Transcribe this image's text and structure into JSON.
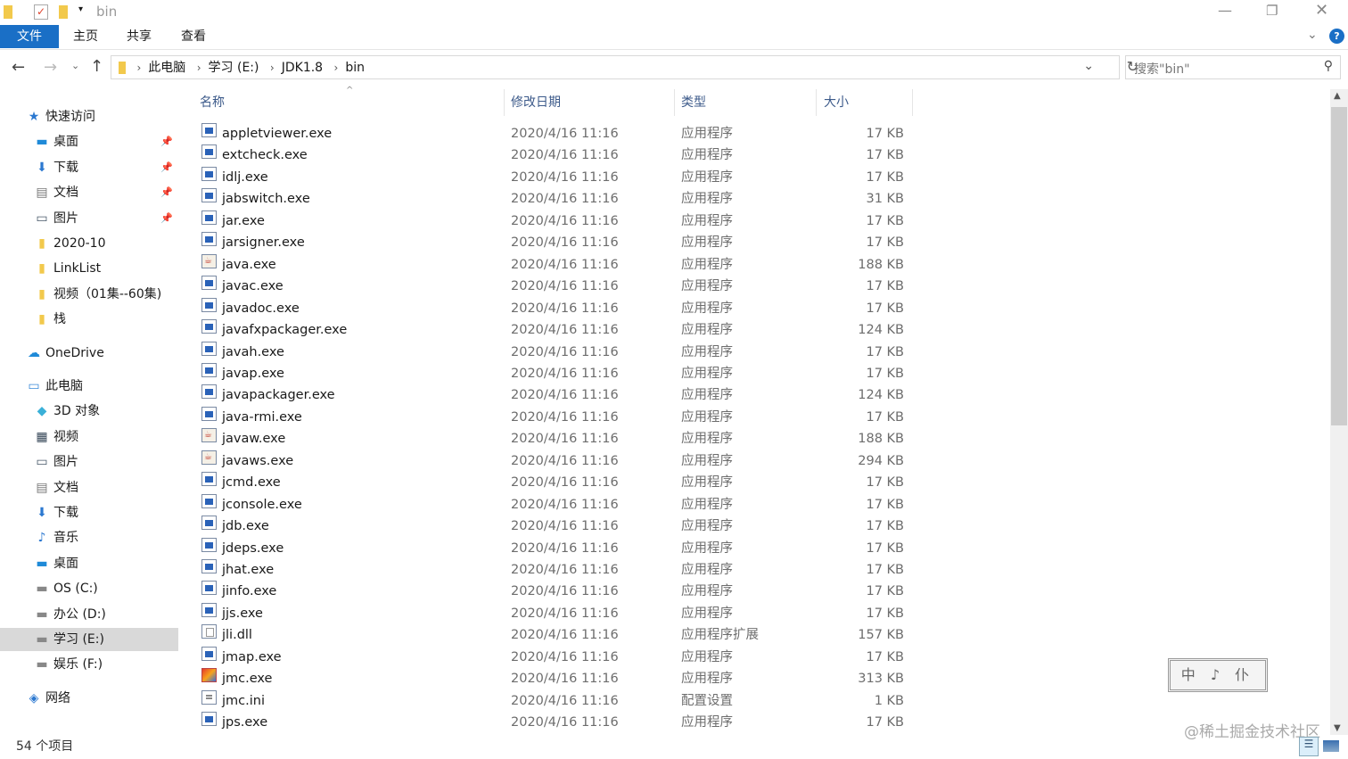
{
  "title": "bin",
  "ribbon": {
    "tabs": [
      "文件",
      "主页",
      "共享",
      "查看"
    ]
  },
  "address": {
    "crumbs": [
      "此电脑",
      "学习 (E:)",
      "JDK1.8",
      "bin"
    ]
  },
  "search": {
    "placeholder": "搜索\"bin\""
  },
  "sidebar": [
    {
      "label": "快速访问",
      "icon": "star",
      "level": 0,
      "pinned": false
    },
    {
      "label": "桌面",
      "icon": "desktop",
      "level": 1,
      "pinned": true
    },
    {
      "label": "下载",
      "icon": "download",
      "level": 1,
      "pinned": true
    },
    {
      "label": "文档",
      "icon": "document",
      "level": 1,
      "pinned": true
    },
    {
      "label": "图片",
      "icon": "picture",
      "level": 1,
      "pinned": true
    },
    {
      "label": "2020-10",
      "icon": "folder",
      "level": 1,
      "pinned": false
    },
    {
      "label": "LinkList",
      "icon": "folder",
      "level": 1,
      "pinned": false
    },
    {
      "label": "视频（01集--60集)",
      "icon": "folder",
      "level": 1,
      "pinned": false
    },
    {
      "label": "栈",
      "icon": "folder",
      "level": 1,
      "pinned": false
    },
    {
      "label": "OneDrive",
      "icon": "cloud",
      "level": 0,
      "pinned": false,
      "gap": true
    },
    {
      "label": "此电脑",
      "icon": "computer",
      "level": 0,
      "pinned": false,
      "gap": true
    },
    {
      "label": "3D 对象",
      "icon": "3d",
      "level": 1,
      "pinned": false
    },
    {
      "label": "视频",
      "icon": "video",
      "level": 1,
      "pinned": false
    },
    {
      "label": "图片",
      "icon": "picture",
      "level": 1,
      "pinned": false
    },
    {
      "label": "文档",
      "icon": "document",
      "level": 1,
      "pinned": false
    },
    {
      "label": "下载",
      "icon": "download",
      "level": 1,
      "pinned": false
    },
    {
      "label": "音乐",
      "icon": "music",
      "level": 1,
      "pinned": false
    },
    {
      "label": "桌面",
      "icon": "desktop",
      "level": 1,
      "pinned": false
    },
    {
      "label": "OS (C:)",
      "icon": "drive",
      "level": 1,
      "pinned": false
    },
    {
      "label": "办公 (D:)",
      "icon": "drive",
      "level": 1,
      "pinned": false
    },
    {
      "label": "学习 (E:)",
      "icon": "drive",
      "level": 1,
      "pinned": false,
      "selected": true
    },
    {
      "label": "娱乐 (F:)",
      "icon": "drive",
      "level": 1,
      "pinned": false
    },
    {
      "label": "网络",
      "icon": "network",
      "level": 0,
      "pinned": false,
      "gap": true
    }
  ],
  "columns": [
    "名称",
    "修改日期",
    "类型",
    "大小"
  ],
  "files": [
    [
      "appletviewer.exe",
      "2020/4/16 11:16",
      "应用程序",
      "17 KB",
      "exe"
    ],
    [
      "extcheck.exe",
      "2020/4/16 11:16",
      "应用程序",
      "17 KB",
      "exe"
    ],
    [
      "idlj.exe",
      "2020/4/16 11:16",
      "应用程序",
      "17 KB",
      "exe"
    ],
    [
      "jabswitch.exe",
      "2020/4/16 11:16",
      "应用程序",
      "31 KB",
      "exe"
    ],
    [
      "jar.exe",
      "2020/4/16 11:16",
      "应用程序",
      "17 KB",
      "exe"
    ],
    [
      "jarsigner.exe",
      "2020/4/16 11:16",
      "应用程序",
      "17 KB",
      "exe"
    ],
    [
      "java.exe",
      "2020/4/16 11:16",
      "应用程序",
      "188 KB",
      "java"
    ],
    [
      "javac.exe",
      "2020/4/16 11:16",
      "应用程序",
      "17 KB",
      "exe"
    ],
    [
      "javadoc.exe",
      "2020/4/16 11:16",
      "应用程序",
      "17 KB",
      "exe"
    ],
    [
      "javafxpackager.exe",
      "2020/4/16 11:16",
      "应用程序",
      "124 KB",
      "exe"
    ],
    [
      "javah.exe",
      "2020/4/16 11:16",
      "应用程序",
      "17 KB",
      "exe"
    ],
    [
      "javap.exe",
      "2020/4/16 11:16",
      "应用程序",
      "17 KB",
      "exe"
    ],
    [
      "javapackager.exe",
      "2020/4/16 11:16",
      "应用程序",
      "124 KB",
      "exe"
    ],
    [
      "java-rmi.exe",
      "2020/4/16 11:16",
      "应用程序",
      "17 KB",
      "exe"
    ],
    [
      "javaw.exe",
      "2020/4/16 11:16",
      "应用程序",
      "188 KB",
      "java"
    ],
    [
      "javaws.exe",
      "2020/4/16 11:16",
      "应用程序",
      "294 KB",
      "java"
    ],
    [
      "jcmd.exe",
      "2020/4/16 11:16",
      "应用程序",
      "17 KB",
      "exe"
    ],
    [
      "jconsole.exe",
      "2020/4/16 11:16",
      "应用程序",
      "17 KB",
      "exe"
    ],
    [
      "jdb.exe",
      "2020/4/16 11:16",
      "应用程序",
      "17 KB",
      "exe"
    ],
    [
      "jdeps.exe",
      "2020/4/16 11:16",
      "应用程序",
      "17 KB",
      "exe"
    ],
    [
      "jhat.exe",
      "2020/4/16 11:16",
      "应用程序",
      "17 KB",
      "exe"
    ],
    [
      "jinfo.exe",
      "2020/4/16 11:16",
      "应用程序",
      "17 KB",
      "exe"
    ],
    [
      "jjs.exe",
      "2020/4/16 11:16",
      "应用程序",
      "17 KB",
      "exe"
    ],
    [
      "jli.dll",
      "2020/4/16 11:16",
      "应用程序扩展",
      "157 KB",
      "dll"
    ],
    [
      "jmap.exe",
      "2020/4/16 11:16",
      "应用程序",
      "17 KB",
      "exe"
    ],
    [
      "jmc.exe",
      "2020/4/16 11:16",
      "应用程序",
      "313 KB",
      "jmc"
    ],
    [
      "jmc.ini",
      "2020/4/16 11:16",
      "配置设置",
      "1 KB",
      "ini"
    ],
    [
      "jps.exe",
      "2020/4/16 11:16",
      "应用程序",
      "17 KB",
      "exe"
    ]
  ],
  "status": "54 个项目",
  "watermark": {
    "stamp": "中 ♪ 仆",
    "text": "@稀土掘金技术社区"
  }
}
